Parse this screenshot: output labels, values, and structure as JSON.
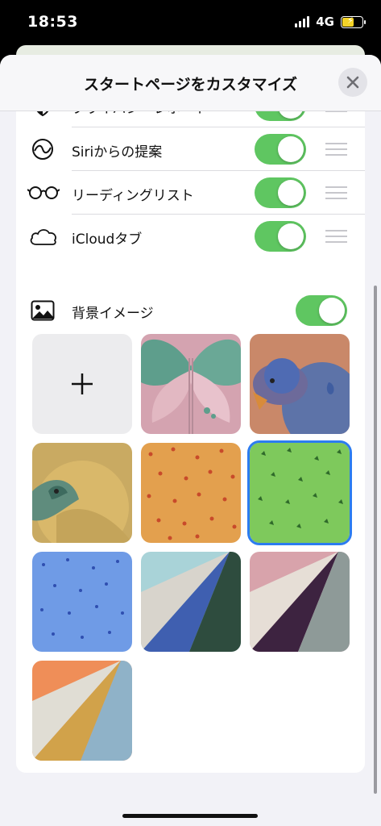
{
  "status": {
    "time": "18:53",
    "network": "4G"
  },
  "header": {
    "title": "スタートページをカスタマイズ"
  },
  "sections": [
    {
      "label": "プライバシーレポート",
      "icon": "shield-icon",
      "enabled": true
    },
    {
      "label": "Siriからの提案",
      "icon": "siri-suggestions-icon",
      "enabled": true
    },
    {
      "label": "リーディングリスト",
      "icon": "glasses-icon",
      "enabled": true
    },
    {
      "label": "iCloudタブ",
      "icon": "cloud-icon",
      "enabled": true
    }
  ],
  "background": {
    "label": "背景イメージ",
    "enabled": true,
    "add_label": "+",
    "images": [
      {
        "name": "butterfly",
        "selected": false
      },
      {
        "name": "bear",
        "selected": false
      },
      {
        "name": "parrot",
        "selected": false
      },
      {
        "name": "orange-pattern",
        "selected": false
      },
      {
        "name": "green-pattern",
        "selected": true
      },
      {
        "name": "blue-pattern",
        "selected": false
      },
      {
        "name": "teal-blue-folds",
        "selected": false
      },
      {
        "name": "pink-purple-folds",
        "selected": false
      },
      {
        "name": "orange-gold-folds",
        "selected": false
      }
    ]
  },
  "colors": {
    "toggle_on": "#5fc661",
    "selection": "#2c7cf0"
  }
}
